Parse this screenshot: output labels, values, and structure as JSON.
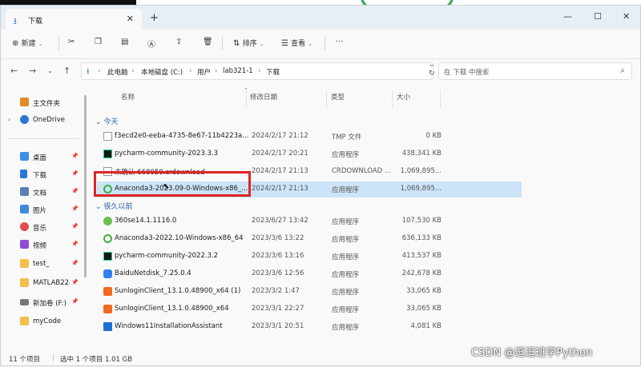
{
  "window": {
    "tab_title": "下载",
    "new_tab": "+",
    "controls": {
      "minimize": "—",
      "maximize": "☐",
      "close": "✕"
    }
  },
  "toolbar": {
    "new_label": "新建",
    "sort_label": "排序",
    "view_label": "查看",
    "more": "···"
  },
  "address": {
    "path": [
      "此电脑",
      "本地磁盘 (C:)",
      "用户",
      "lab321-1",
      "下载"
    ]
  },
  "search": {
    "placeholder": "在 下载 中搜索"
  },
  "sidebar": {
    "items": [
      {
        "label": "主文件夹",
        "icon": "home-icon",
        "color": "#e0892b"
      },
      {
        "label": "OneDrive",
        "icon": "cloud-icon",
        "color": "#2a78d6"
      },
      {
        "label": "桌面",
        "icon": "desktop-icon",
        "color": "#3d8ee6"
      },
      {
        "label": "下载",
        "icon": "download-icon",
        "color": "#2a78d6"
      },
      {
        "label": "文档",
        "icon": "document-icon",
        "color": "#5a7fb5"
      },
      {
        "label": "图片",
        "icon": "pictures-icon",
        "color": "#3f89d8"
      },
      {
        "label": "音乐",
        "icon": "music-icon",
        "color": "#e24b4b"
      },
      {
        "label": "视频",
        "icon": "video-icon",
        "color": "#8e4bd8"
      },
      {
        "label": "test_",
        "icon": "folder-icon",
        "color": "#f0c04a"
      },
      {
        "label": "MATLAB22a",
        "icon": "folder-icon",
        "color": "#f0c04a"
      },
      {
        "label": "新加卷 (F:)",
        "icon": "drive-icon",
        "color": "#777777"
      },
      {
        "label": "myCode",
        "icon": "folder-icon",
        "color": "#f0c04a"
      }
    ]
  },
  "columns": {
    "name": "名称",
    "date": "修改日期",
    "type": "类型",
    "size": "大小"
  },
  "groups": {
    "today": "今天",
    "long_ago": "很久以前"
  },
  "files_today": [
    {
      "name": "f3ecd2e0-eeba-4735-8e67-11b4223a...",
      "date": "2024/2/17 21:12",
      "type": "TMP 文件",
      "size": "0 KB",
      "icon": "tmp-file-icon"
    },
    {
      "name": "pycharm-community-2023.3.3",
      "date": "2024/2/17 20:21",
      "type": "应用程序",
      "size": "438,341 KB",
      "icon": "pycharm-icon"
    },
    {
      "name": "未确认 668050.crdownload",
      "date": "2024/2/17 21:13",
      "type": "CRDOWNLOAD ...",
      "size": "1,069,895...",
      "icon": "crdownload-file-icon"
    },
    {
      "name": "Anaconda3-2023.09-0-Windows-x86_...",
      "date": "2024/2/17 21:13",
      "type": "应用程序",
      "size": "1,069,895...",
      "icon": "anaconda-icon"
    }
  ],
  "files_old": [
    {
      "name": "360se14.1.1116.0",
      "date": "2023/6/27 13:42",
      "type": "应用程序",
      "size": "107,530 KB",
      "icon": "360-browser-icon"
    },
    {
      "name": "Anaconda3-2022.10-Windows-x86_64",
      "date": "2023/3/6 13:22",
      "type": "应用程序",
      "size": "636,133 KB",
      "icon": "anaconda-icon"
    },
    {
      "name": "pycharm-community-2022.3.2",
      "date": "2023/3/6 13:16",
      "type": "应用程序",
      "size": "413,537 KB",
      "icon": "pycharm-icon"
    },
    {
      "name": "BaiduNetdisk_7.25.0.4",
      "date": "2023/3/6 12:56",
      "type": "应用程序",
      "size": "242,678 KB",
      "icon": "baidu-netdisk-icon"
    },
    {
      "name": "SunloginClient_13.1.0.48900_x64 (1)",
      "date": "2023/3/2 1:47",
      "type": "应用程序",
      "size": "33,065 KB",
      "icon": "sunlogin-icon"
    },
    {
      "name": "SunloginClient_13.1.0.48900_x64",
      "date": "2023/3/1 22:27",
      "type": "应用程序",
      "size": "33,065 KB",
      "icon": "sunlogin-icon"
    },
    {
      "name": "Windows11InstallationAssistant",
      "date": "2023/3/1 20:51",
      "type": "应用程序",
      "size": "4,081 KB",
      "icon": "windows-icon"
    }
  ],
  "status": {
    "count": "11 个项目",
    "selected": "选中 1 个项目  1.01 GB"
  },
  "watermark": "CSDN @逗逗班学Python"
}
